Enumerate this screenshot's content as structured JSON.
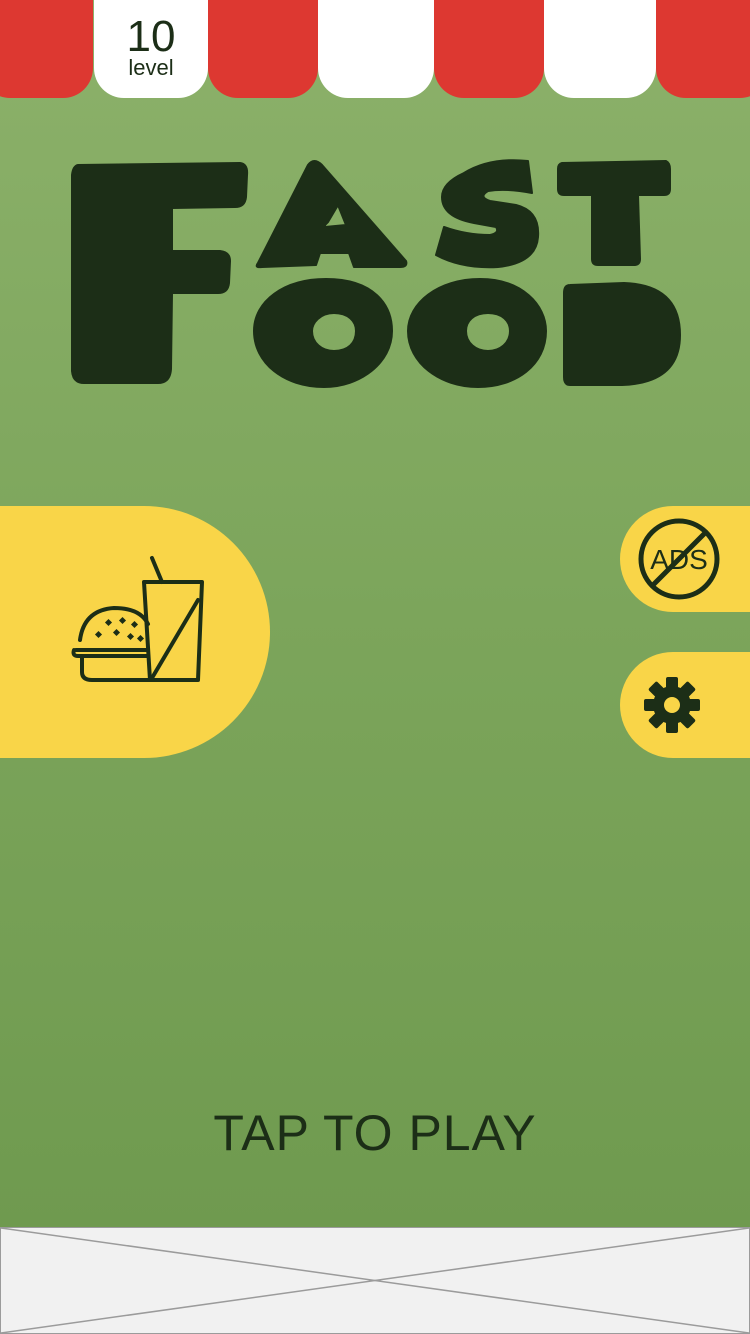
{
  "level": {
    "number": "10",
    "label": "level"
  },
  "title": {
    "word1": "FAST",
    "word2": "FOOD"
  },
  "play_prompt": "TAP TO PLAY",
  "buttons": {
    "shop_icon": "burger-drink-icon",
    "no_ads_text": "ADS",
    "settings_icon": "gear-icon"
  },
  "colors": {
    "awning_red": "#dd3831",
    "background_green": "#7ca55b",
    "button_yellow": "#f9d548",
    "ink": "#1c2e17",
    "ad_placeholder": "#f1f1f1"
  }
}
